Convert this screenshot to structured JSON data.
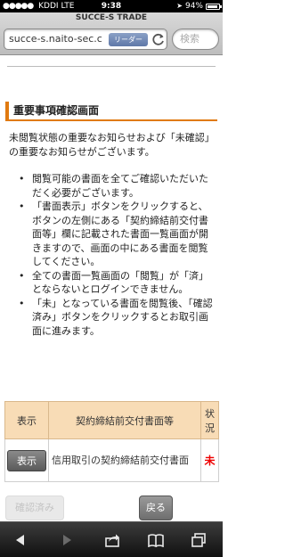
{
  "status_bar": {
    "carrier": "KDDI",
    "network": "LTE",
    "time": "9:38",
    "battery": "94%",
    "battery_level": 0.94
  },
  "browser": {
    "page_title": "SUCCE-S TRADE",
    "url": "succe-s.naito-sec.c",
    "reader_label": "リーダー",
    "search_placeholder": "検索"
  },
  "content": {
    "section_title": "重要事項確認画面",
    "intro": "未閲覧状態の重要なお知らせおよび「未確認」の重要なお知らせがございます。",
    "bullets": [
      "閲覧可能の書面を全てご確認いただいただく必要がございます。",
      "「書面表示」ボタンをクリックすると、ボタンの左側にある「契約締結前交付書面等」欄に記載された書面一覧画面が開きますので、画面の中にある書面を閲覧してください。",
      "全ての書面一覧画面の「閲覧」が「済」とならないとログインできません。",
      "「未」となっている書面を閲覧後、「確認済み」ボタンをクリックするとお取引画面に進みます。"
    ],
    "table": {
      "headers": [
        "表示",
        "契約締結前交付書面等",
        "状況"
      ],
      "rows": [
        {
          "button": "表示",
          "document": "信用取引の契約締結前交付書面",
          "status": "未"
        }
      ]
    },
    "confirm_button": "確認済み",
    "back_button": "戻る"
  },
  "colors": {
    "accent": "#e07a10",
    "table_header": "#f8dcb6",
    "status_unread": "#ee0000"
  },
  "icons": {
    "toolbar": [
      "back-arrow-icon",
      "forward-arrow-icon",
      "share-icon",
      "bookmarks-icon",
      "tabs-icon"
    ]
  }
}
